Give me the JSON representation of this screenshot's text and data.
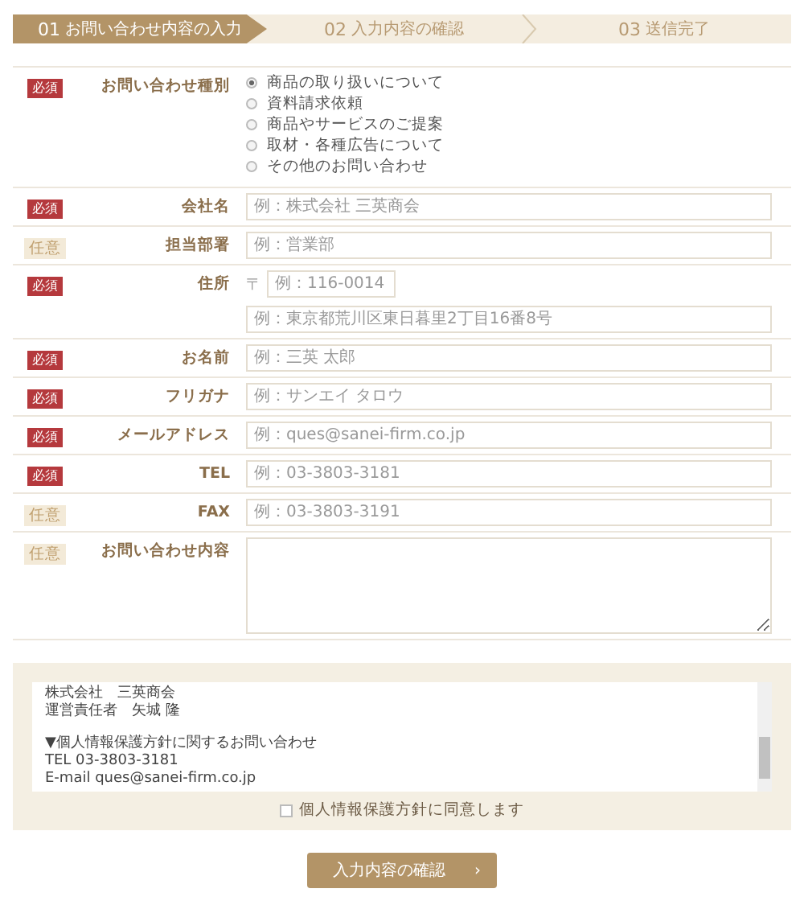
{
  "steps": [
    {
      "number": "01",
      "label": "お問い合わせ内容の入力",
      "selected": true
    },
    {
      "number": "02",
      "label": "入力内容の確認",
      "selected": false
    },
    {
      "number": "03",
      "label": "送信完了",
      "selected": false
    }
  ],
  "fields": [
    {
      "kind": "radio",
      "badge": "必須",
      "required": true,
      "label": "お問い合わせ種別",
      "options": [
        {
          "label": "商品の取り扱いについて",
          "selected": true
        },
        {
          "label": "資料請求依頼",
          "selected": false
        },
        {
          "label": "商品やサービスのご提案",
          "selected": false
        },
        {
          "label": "取材・各種広告について",
          "selected": false
        },
        {
          "label": "その他のお問い合わせ",
          "selected": false
        }
      ]
    },
    {
      "kind": "text",
      "badge": "必須",
      "required": true,
      "label": "会社名",
      "placeholder": "例：株式会社 三英商会"
    },
    {
      "kind": "text",
      "badge": "任意",
      "required": false,
      "label": "担当部署",
      "placeholder": "例：営業部"
    },
    {
      "kind": "address",
      "badge": "必須",
      "required": true,
      "label": "住所",
      "postal_mark": "〒",
      "postal_placeholder": "例：116-0014",
      "placeholder": "例：東京都荒川区東日暮里2丁目16番8号"
    },
    {
      "kind": "text",
      "badge": "必須",
      "required": true,
      "label": "お名前",
      "placeholder": "例：三英 太郎"
    },
    {
      "kind": "text",
      "badge": "必須",
      "required": true,
      "label": "フリガナ",
      "placeholder": "例：サンエイ タロウ"
    },
    {
      "kind": "text",
      "badge": "必須",
      "required": true,
      "label": "メールアドレス",
      "placeholder": "例：ques@sanei-firm.co.jp"
    },
    {
      "kind": "text",
      "badge": "必須",
      "required": true,
      "label": "TEL",
      "placeholder": "例：03-3803-3181"
    },
    {
      "kind": "text",
      "badge": "任意",
      "required": false,
      "label": "FAX",
      "placeholder": "例：03-3803-3191"
    },
    {
      "kind": "textarea",
      "badge": "任意",
      "required": false,
      "label": "お問い合わせ内容"
    }
  ],
  "privacy": {
    "blocks": [
      {
        "lines": [
          "株式会社　三英商会",
          "運営責任者　矢城 隆"
        ]
      },
      {
        "lines": [
          "▼個人情報保護方針に関するお問い合わせ",
          "TEL 03-3803-3181",
          "E-mail ques@sanei-firm.co.jp"
        ]
      }
    ],
    "agree": {
      "label": "個人情報保護方針に同意します",
      "checked": false
    }
  },
  "submit": {
    "label": "入力内容の確認",
    "arrow": "›"
  }
}
